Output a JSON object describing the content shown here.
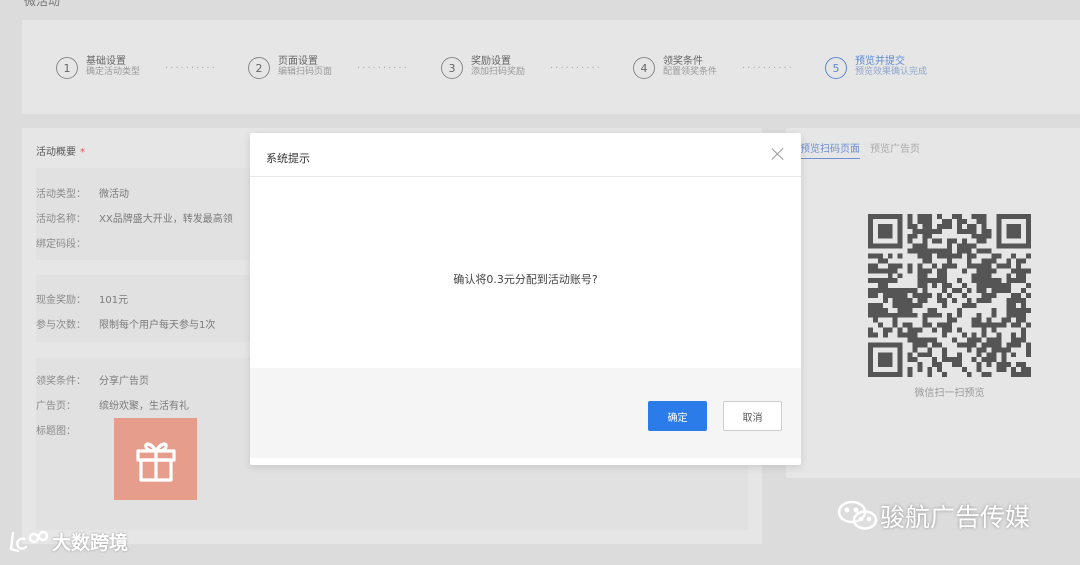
{
  "page": {
    "heading": "微活动"
  },
  "steps": [
    {
      "num": "1",
      "title": "基础设置",
      "sub": "确定活动类型"
    },
    {
      "num": "2",
      "title": "页面设置",
      "sub": "编辑扫码页面"
    },
    {
      "num": "3",
      "title": "奖励设置",
      "sub": "添加扫码奖励"
    },
    {
      "num": "4",
      "title": "领奖条件",
      "sub": "配置领奖条件"
    },
    {
      "num": "5",
      "title": "预览并提交",
      "sub": "预览效果确认完成"
    }
  ],
  "step_dots": "··········",
  "summary": {
    "title": "活动概要",
    "required_mark": "*",
    "rows": [
      {
        "label": "活动类型：",
        "value": "微活动"
      },
      {
        "label": "活动名称：",
        "value": "XX品牌盛大开业，转发最高领"
      },
      {
        "label": "绑定码段：",
        "value": ""
      },
      {
        "label": "现金奖励：",
        "value": "101元"
      },
      {
        "label": "参与次数：",
        "value": "限制每个用户每天参与1次"
      },
      {
        "label": "领奖条件：",
        "value": "分享广告页"
      },
      {
        "label": "广告页：",
        "value": "缤纷欢聚，生活有礼"
      },
      {
        "label": "标题图：",
        "value": ""
      }
    ]
  },
  "preview": {
    "tabs": [
      "预览扫码页面",
      "预览广告页"
    ],
    "qr_caption": "微信扫一扫预览"
  },
  "modal": {
    "title": "系统提示",
    "message": "确认将0.3元分配到活动账号?",
    "confirm_label": "确定",
    "cancel_label": "取消"
  },
  "watermarks": {
    "left": "大数跨境",
    "right": "骏航广告传媒"
  },
  "colors": {
    "primary": "#2b7ce8",
    "active_step": "#5b8ad6",
    "gift_bg": "#e69d8c",
    "required": "#e15b5b"
  }
}
